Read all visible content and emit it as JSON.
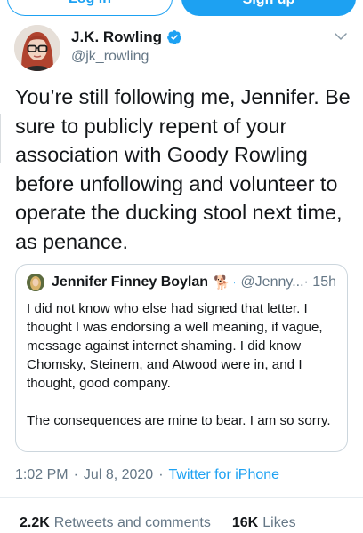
{
  "header": {
    "login_label": "Log in",
    "signup_label": "Sign up"
  },
  "tweet": {
    "author_name": "J.K. Rowling",
    "author_handle": "@jk_rowling",
    "text": "You’re still following me, Jennifer. Be sure to publicly repent of your association with Goody Rowling before unfollowing and volunteer to operate the ducking stool next time, as penance.",
    "time": "1:02 PM",
    "date": "Jul 8, 2020",
    "source": "Twitter for iPhone",
    "separator": "·"
  },
  "quote": {
    "author_name": "Jennifer Finney Boylan",
    "emoji": "🐕",
    "author_handle": "@Jenny...",
    "time": "· 15h",
    "paragraph1": "I did not know who else had signed that letter.  I thought I was endorsing a well meaning, if vague, message against internet shaming.  I did know Chomsky, Steinem, and Atwood were in, and I thought, good company.",
    "paragraph2": "The consequences are mine to bear. I am so sorry."
  },
  "stats": {
    "retweets_count": "2.2K",
    "retweets_label": "Retweets and comments",
    "likes_count": "16K",
    "likes_label": "Likes"
  },
  "colors": {
    "accent": "#1da1f2",
    "secondary_text": "#657786",
    "primary_text": "#14171a",
    "border": "#ccd6dd"
  },
  "icons": {
    "verified": "verified-badge-icon",
    "caret": "chevron-down-icon"
  }
}
